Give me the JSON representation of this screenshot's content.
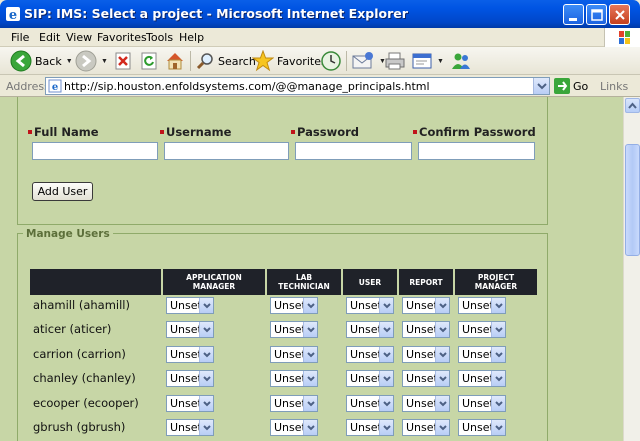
{
  "window": {
    "title": "SIP: IMS: Select a project - Microsoft Internet Explorer"
  },
  "menu": [
    "File",
    "Edit",
    "View",
    "Favorites",
    "Tools",
    "Help"
  ],
  "toolbar": {
    "back_label": "Back",
    "search_label": "Search",
    "favorites_label": "Favorites"
  },
  "address": {
    "label": "Address",
    "url": "http://sip.houston.enfoldsystems.com/@@manage_principals.html",
    "go_label": "Go",
    "links_label": "Links"
  },
  "add_form": {
    "full_name_label": "Full Name",
    "username_label": "Username",
    "password_label": "Password",
    "confirm_password_label": "Confirm Password",
    "full_name_value": "",
    "username_value": "",
    "password_value": "",
    "confirm_password_value": "",
    "add_button_label": "Add User"
  },
  "manage": {
    "legend": "Manage Users",
    "columns": [
      "APPLICATION MANAGER",
      "LAB TECHNICIAN",
      "USER",
      "REPORT",
      "PROJECT MANAGER"
    ],
    "columns_display": [
      [
        "APPLICATION",
        "MANAGER"
      ],
      [
        "LAB",
        "TECHNICIAN"
      ],
      [
        "USER"
      ],
      [
        "REPORT"
      ],
      [
        "PROJECT",
        "MANAGER"
      ]
    ],
    "rows": [
      {
        "user": "ahamill (ahamill)",
        "values": [
          "Unset",
          "Unset",
          "Unset",
          "Unset",
          "Unset"
        ]
      },
      {
        "user": "aticer (aticer)",
        "values": [
          "Unset",
          "Unset",
          "Unset",
          "Unset",
          "Unset"
        ]
      },
      {
        "user": "carrion (carrion)",
        "values": [
          "Unset",
          "Unset",
          "Unset",
          "Unset",
          "Unset"
        ]
      },
      {
        "user": "chanley (chanley)",
        "values": [
          "Unset",
          "Unset",
          "Unset",
          "Unset",
          "Unset"
        ]
      },
      {
        "user": "ecooper (ecooper)",
        "values": [
          "Unset",
          "Unset",
          "Unset",
          "Unset",
          "Unset"
        ]
      },
      {
        "user": "gbrush (gbrush)",
        "values": [
          "Unset",
          "Unset",
          "Unset",
          "Unset",
          "Unset"
        ]
      }
    ]
  },
  "colors": {
    "page_background": "#c7d6a6",
    "table_header": "#1f2229",
    "required_marker": "#c0141a",
    "titlebar": "#0054e3"
  },
  "icons": {
    "title": "ie-logo-icon",
    "back": "back-arrow-icon",
    "forward": "forward-arrow-icon",
    "stop": "stop-icon",
    "refresh": "refresh-icon",
    "home": "home-icon",
    "search": "search-icon",
    "favorites": "favorites-star-icon",
    "history": "history-icon",
    "mail": "mail-icon",
    "print": "print-icon",
    "edit": "edit-icon",
    "messenger": "messenger-icon"
  }
}
